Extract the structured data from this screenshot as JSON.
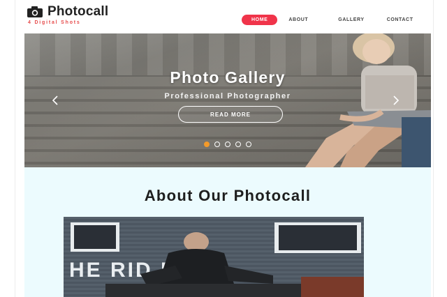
{
  "brand": {
    "title": "Photocall",
    "tagline": "4 Digital Shots",
    "icon": "camera-icon"
  },
  "nav": {
    "items": [
      {
        "label": "HOME",
        "active": true
      },
      {
        "label": "ABOUT",
        "active": false
      },
      {
        "label": "GALLERY",
        "active": false
      },
      {
        "label": "CONTACT",
        "active": false
      }
    ]
  },
  "hero": {
    "title": "Photo Gallery",
    "subtitle": "Professional Photographer",
    "button_label": "READ MORE",
    "prev_icon": "chevron-left-icon",
    "next_icon": "chevron-right-icon",
    "slide_count": 5,
    "active_slide": 1
  },
  "about": {
    "title": "About Our Photocall",
    "sign_text": "HE RID  EMY"
  },
  "colors": {
    "accent": "#f0344a",
    "tagline": "#e64a4a",
    "dot_active": "#f39a2a",
    "about_bg": "#ecfbfe"
  }
}
